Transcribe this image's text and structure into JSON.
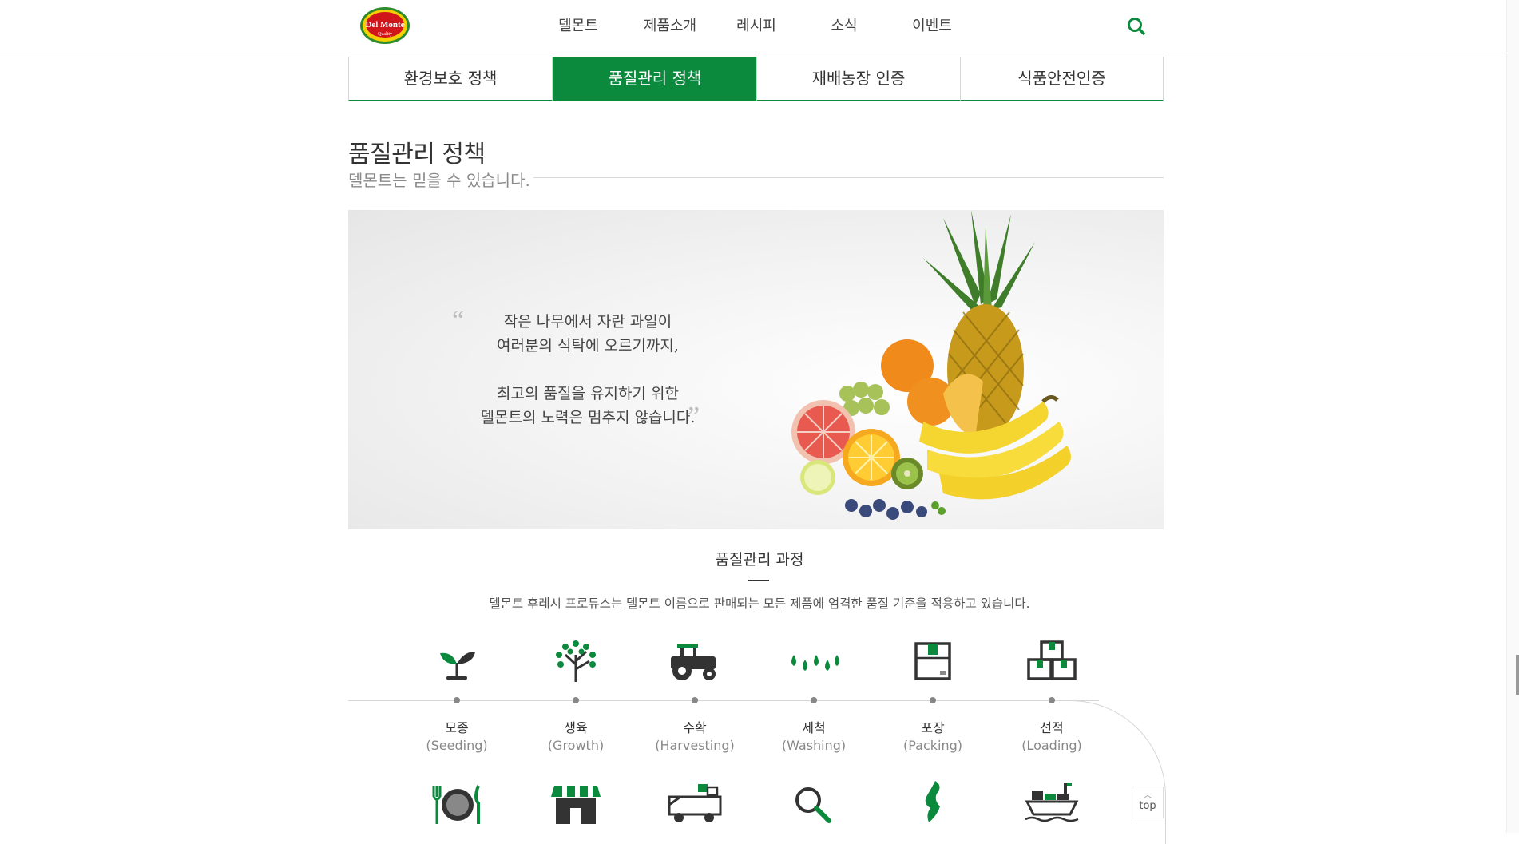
{
  "header": {
    "logo_text": "Del Monte",
    "logo_sub": "Quality",
    "nav": [
      "델몬트",
      "제품소개",
      "레시피",
      "소식",
      "이벤트"
    ],
    "search_icon": "search-icon",
    "accent_color": "#0b8a3e"
  },
  "tabs": [
    {
      "label": "환경보호 정책",
      "active": false
    },
    {
      "label": "품질관리 정책",
      "active": true
    },
    {
      "label": "재배농장 인증",
      "active": false
    },
    {
      "label": "식품안전인증",
      "active": false
    }
  ],
  "page": {
    "title": "품질관리 정책",
    "subtitle": "델몬트는 믿을 수 있습니다."
  },
  "hero": {
    "quote_lines": [
      "작은 나무에서 자란 과일이",
      "여러분의 식탁에 오르기까지,",
      "",
      "최고의 품질을 유지하기 위한",
      "델몬트의 노력은 멈추지 않습니다."
    ],
    "open_mark": "“",
    "close_mark": "”"
  },
  "process": {
    "title": "품질관리 과정",
    "description": "델몬트 후레시 프로듀스는 델몬트 이름으로 판매되는 모든 제품에 엄격한 품질 기준을 적용하고 있습니다.",
    "steps": [
      {
        "kr": "모종",
        "en": "(Seeding)",
        "icon": "seedling-icon"
      },
      {
        "kr": "생육",
        "en": "(Growth)",
        "icon": "tree-icon"
      },
      {
        "kr": "수확",
        "en": "(Harvesting)",
        "icon": "tractor-icon"
      },
      {
        "kr": "세척",
        "en": "(Washing)",
        "icon": "water-drops-icon"
      },
      {
        "kr": "포장",
        "en": "(Packing)",
        "icon": "box-icon"
      },
      {
        "kr": "선적",
        "en": "(Loading)",
        "icon": "stacked-boxes-icon"
      }
    ],
    "row2_icons": [
      "dish-icon",
      "store-icon",
      "truck-icon",
      "magnifier-icon",
      "map-icon",
      "ship-icon"
    ]
  },
  "top_button": {
    "label": "top"
  }
}
